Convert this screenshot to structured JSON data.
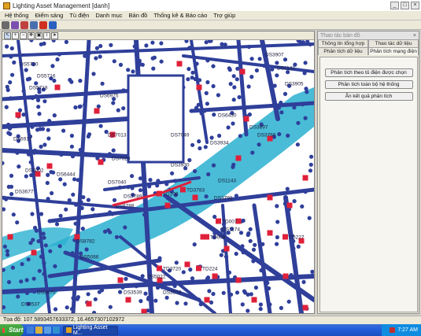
{
  "window": {
    "title": "Lighting Asset Management [danh]",
    "minimize": "_",
    "maximize": "□",
    "close": "×"
  },
  "menu": [
    "Hệ thống",
    "Điểm sáng",
    "Tủ điện",
    "Danh mục",
    "Bản đồ",
    "Thống kê & Báo cáo",
    "Trợ giúp"
  ],
  "toolbar_icons": [
    {
      "name": "home-icon",
      "color": "#6a6a6a"
    },
    {
      "name": "shield-icon",
      "color": "#7a4fb0"
    },
    {
      "name": "tools-icon",
      "color": "#c04040"
    },
    {
      "name": "save-icon",
      "color": "#4a6fb0"
    },
    {
      "name": "stop-icon",
      "color": "#d03020"
    },
    {
      "name": "help-icon",
      "color": "#2a60c0"
    }
  ],
  "map_tools": [
    {
      "name": "select-tool-icon",
      "glyph": "↖"
    },
    {
      "name": "zoom-in-icon",
      "glyph": "+"
    },
    {
      "name": "zoom-out-icon",
      "glyph": "−"
    },
    {
      "name": "pan-icon",
      "glyph": "✥"
    },
    {
      "name": "full-extent-icon",
      "glyph": "▣"
    },
    {
      "name": "info-icon",
      "glyph": "i"
    },
    {
      "name": "pointer-icon",
      "glyph": "➤"
    }
  ],
  "map_labels": [
    {
      "text": "DS5720",
      "kind": "ds"
    },
    {
      "text": "DS5716",
      "kind": "ds"
    },
    {
      "text": "DS5718",
      "kind": "ds"
    },
    {
      "text": "DS6975",
      "kind": "ds"
    },
    {
      "text": "DS6917",
      "kind": "ds"
    },
    {
      "text": "DS7002",
      "kind": "ds"
    },
    {
      "text": "DS7013",
      "kind": "ds"
    },
    {
      "text": "DS7020",
      "kind": "ds"
    },
    {
      "text": "DS7040",
      "kind": "ds"
    },
    {
      "text": "DS7049",
      "kind": "ds"
    },
    {
      "text": "DS3930",
      "kind": "ds"
    },
    {
      "text": "DS3934",
      "kind": "ds"
    },
    {
      "text": "DS3897",
      "kind": "ds"
    },
    {
      "text": "DS3907",
      "kind": "ds"
    },
    {
      "text": "DS3905",
      "kind": "ds"
    },
    {
      "text": "DS1147",
      "kind": "ds"
    },
    {
      "text": "DS1143",
      "kind": "ds"
    },
    {
      "text": "DS3798",
      "kind": "ds"
    },
    {
      "text": "DS3789",
      "kind": "ds"
    },
    {
      "text": "DS8788",
      "kind": "ds"
    },
    {
      "text": "DS8782",
      "kind": "ds"
    },
    {
      "text": "DS5066",
      "kind": "ds"
    },
    {
      "text": "DS3677",
      "kind": "ds"
    },
    {
      "text": "DS3670",
      "kind": "ds"
    },
    {
      "text": "DS3537",
      "kind": "ds"
    },
    {
      "text": "DS3539",
      "kind": "ds"
    },
    {
      "text": "DS3528",
      "kind": "ds"
    },
    {
      "text": "DS5022",
      "kind": "ds"
    },
    {
      "text": "DS6444",
      "kind": "ds"
    },
    {
      "text": "DS6430",
      "kind": "ds"
    },
    {
      "text": "DS1174",
      "kind": "ds"
    },
    {
      "text": "DS3766",
      "kind": "ds"
    },
    {
      "text": "TD106",
      "kind": "td"
    },
    {
      "text": "TD007",
      "kind": "td"
    },
    {
      "text": "TD008",
      "kind": "td"
    },
    {
      "text": "TD227",
      "kind": "td"
    },
    {
      "text": "TD224",
      "kind": "td"
    },
    {
      "text": "TD3720",
      "kind": "td"
    },
    {
      "text": "TD3783",
      "kind": "td"
    }
  ],
  "side_panel": {
    "header": "Thao tác bản đồ",
    "close": "×",
    "tabs_row1": [
      "Thông tin tổng hợp",
      "Thao tác dữ liệu"
    ],
    "tabs_row2": [
      "Phân tích dữ liệu",
      "Phân tích mạng điện"
    ],
    "actions": [
      "Phân tích theo tủ điện được chọn",
      "Phân tích toàn bộ hệ thống",
      "Ẩn kết quả phân tích"
    ]
  },
  "status": {
    "label": "Tọa độ:",
    "coords": "107.5893457633372, 16.4657307102972"
  },
  "taskbar": {
    "start": "Start",
    "task_button": "Lighting Asset M...",
    "clock": "7:27 AM"
  },
  "colors": {
    "network": "#2f3f9a",
    "river": "#2ab0d0",
    "cabinet": "#e0203a",
    "map_bg": "#ffffff"
  }
}
